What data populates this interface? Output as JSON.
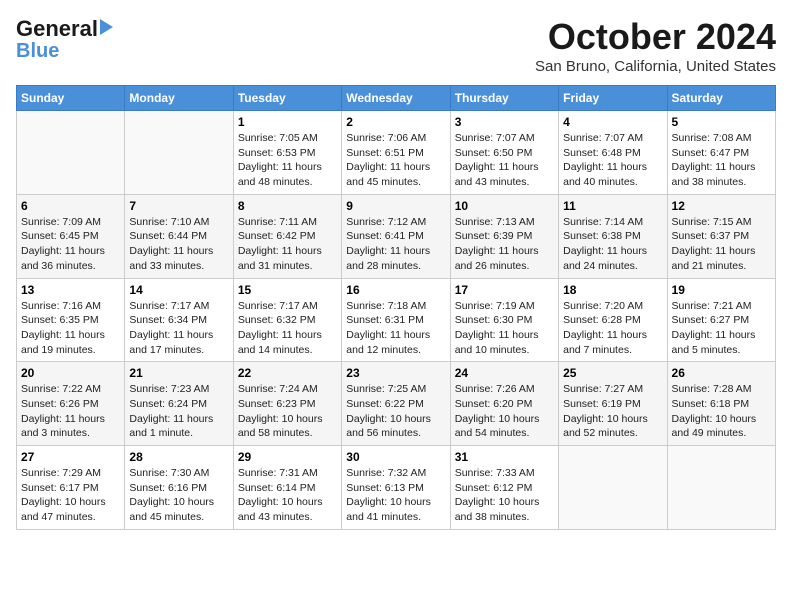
{
  "logo": {
    "line1": "General",
    "line2": "Blue"
  },
  "title": "October 2024",
  "subtitle": "San Bruno, California, United States",
  "days_of_week": [
    "Sunday",
    "Monday",
    "Tuesday",
    "Wednesday",
    "Thursday",
    "Friday",
    "Saturday"
  ],
  "weeks": [
    [
      {
        "day": "",
        "info": ""
      },
      {
        "day": "",
        "info": ""
      },
      {
        "day": "1",
        "info": "Sunrise: 7:05 AM\nSunset: 6:53 PM\nDaylight: 11 hours and 48 minutes."
      },
      {
        "day": "2",
        "info": "Sunrise: 7:06 AM\nSunset: 6:51 PM\nDaylight: 11 hours and 45 minutes."
      },
      {
        "day": "3",
        "info": "Sunrise: 7:07 AM\nSunset: 6:50 PM\nDaylight: 11 hours and 43 minutes."
      },
      {
        "day": "4",
        "info": "Sunrise: 7:07 AM\nSunset: 6:48 PM\nDaylight: 11 hours and 40 minutes."
      },
      {
        "day": "5",
        "info": "Sunrise: 7:08 AM\nSunset: 6:47 PM\nDaylight: 11 hours and 38 minutes."
      }
    ],
    [
      {
        "day": "6",
        "info": "Sunrise: 7:09 AM\nSunset: 6:45 PM\nDaylight: 11 hours and 36 minutes."
      },
      {
        "day": "7",
        "info": "Sunrise: 7:10 AM\nSunset: 6:44 PM\nDaylight: 11 hours and 33 minutes."
      },
      {
        "day": "8",
        "info": "Sunrise: 7:11 AM\nSunset: 6:42 PM\nDaylight: 11 hours and 31 minutes."
      },
      {
        "day": "9",
        "info": "Sunrise: 7:12 AM\nSunset: 6:41 PM\nDaylight: 11 hours and 28 minutes."
      },
      {
        "day": "10",
        "info": "Sunrise: 7:13 AM\nSunset: 6:39 PM\nDaylight: 11 hours and 26 minutes."
      },
      {
        "day": "11",
        "info": "Sunrise: 7:14 AM\nSunset: 6:38 PM\nDaylight: 11 hours and 24 minutes."
      },
      {
        "day": "12",
        "info": "Sunrise: 7:15 AM\nSunset: 6:37 PM\nDaylight: 11 hours and 21 minutes."
      }
    ],
    [
      {
        "day": "13",
        "info": "Sunrise: 7:16 AM\nSunset: 6:35 PM\nDaylight: 11 hours and 19 minutes."
      },
      {
        "day": "14",
        "info": "Sunrise: 7:17 AM\nSunset: 6:34 PM\nDaylight: 11 hours and 17 minutes."
      },
      {
        "day": "15",
        "info": "Sunrise: 7:17 AM\nSunset: 6:32 PM\nDaylight: 11 hours and 14 minutes."
      },
      {
        "day": "16",
        "info": "Sunrise: 7:18 AM\nSunset: 6:31 PM\nDaylight: 11 hours and 12 minutes."
      },
      {
        "day": "17",
        "info": "Sunrise: 7:19 AM\nSunset: 6:30 PM\nDaylight: 11 hours and 10 minutes."
      },
      {
        "day": "18",
        "info": "Sunrise: 7:20 AM\nSunset: 6:28 PM\nDaylight: 11 hours and 7 minutes."
      },
      {
        "day": "19",
        "info": "Sunrise: 7:21 AM\nSunset: 6:27 PM\nDaylight: 11 hours and 5 minutes."
      }
    ],
    [
      {
        "day": "20",
        "info": "Sunrise: 7:22 AM\nSunset: 6:26 PM\nDaylight: 11 hours and 3 minutes."
      },
      {
        "day": "21",
        "info": "Sunrise: 7:23 AM\nSunset: 6:24 PM\nDaylight: 11 hours and 1 minute."
      },
      {
        "day": "22",
        "info": "Sunrise: 7:24 AM\nSunset: 6:23 PM\nDaylight: 10 hours and 58 minutes."
      },
      {
        "day": "23",
        "info": "Sunrise: 7:25 AM\nSunset: 6:22 PM\nDaylight: 10 hours and 56 minutes."
      },
      {
        "day": "24",
        "info": "Sunrise: 7:26 AM\nSunset: 6:20 PM\nDaylight: 10 hours and 54 minutes."
      },
      {
        "day": "25",
        "info": "Sunrise: 7:27 AM\nSunset: 6:19 PM\nDaylight: 10 hours and 52 minutes."
      },
      {
        "day": "26",
        "info": "Sunrise: 7:28 AM\nSunset: 6:18 PM\nDaylight: 10 hours and 49 minutes."
      }
    ],
    [
      {
        "day": "27",
        "info": "Sunrise: 7:29 AM\nSunset: 6:17 PM\nDaylight: 10 hours and 47 minutes."
      },
      {
        "day": "28",
        "info": "Sunrise: 7:30 AM\nSunset: 6:16 PM\nDaylight: 10 hours and 45 minutes."
      },
      {
        "day": "29",
        "info": "Sunrise: 7:31 AM\nSunset: 6:14 PM\nDaylight: 10 hours and 43 minutes."
      },
      {
        "day": "30",
        "info": "Sunrise: 7:32 AM\nSunset: 6:13 PM\nDaylight: 10 hours and 41 minutes."
      },
      {
        "day": "31",
        "info": "Sunrise: 7:33 AM\nSunset: 6:12 PM\nDaylight: 10 hours and 38 minutes."
      },
      {
        "day": "",
        "info": ""
      },
      {
        "day": "",
        "info": ""
      }
    ]
  ]
}
